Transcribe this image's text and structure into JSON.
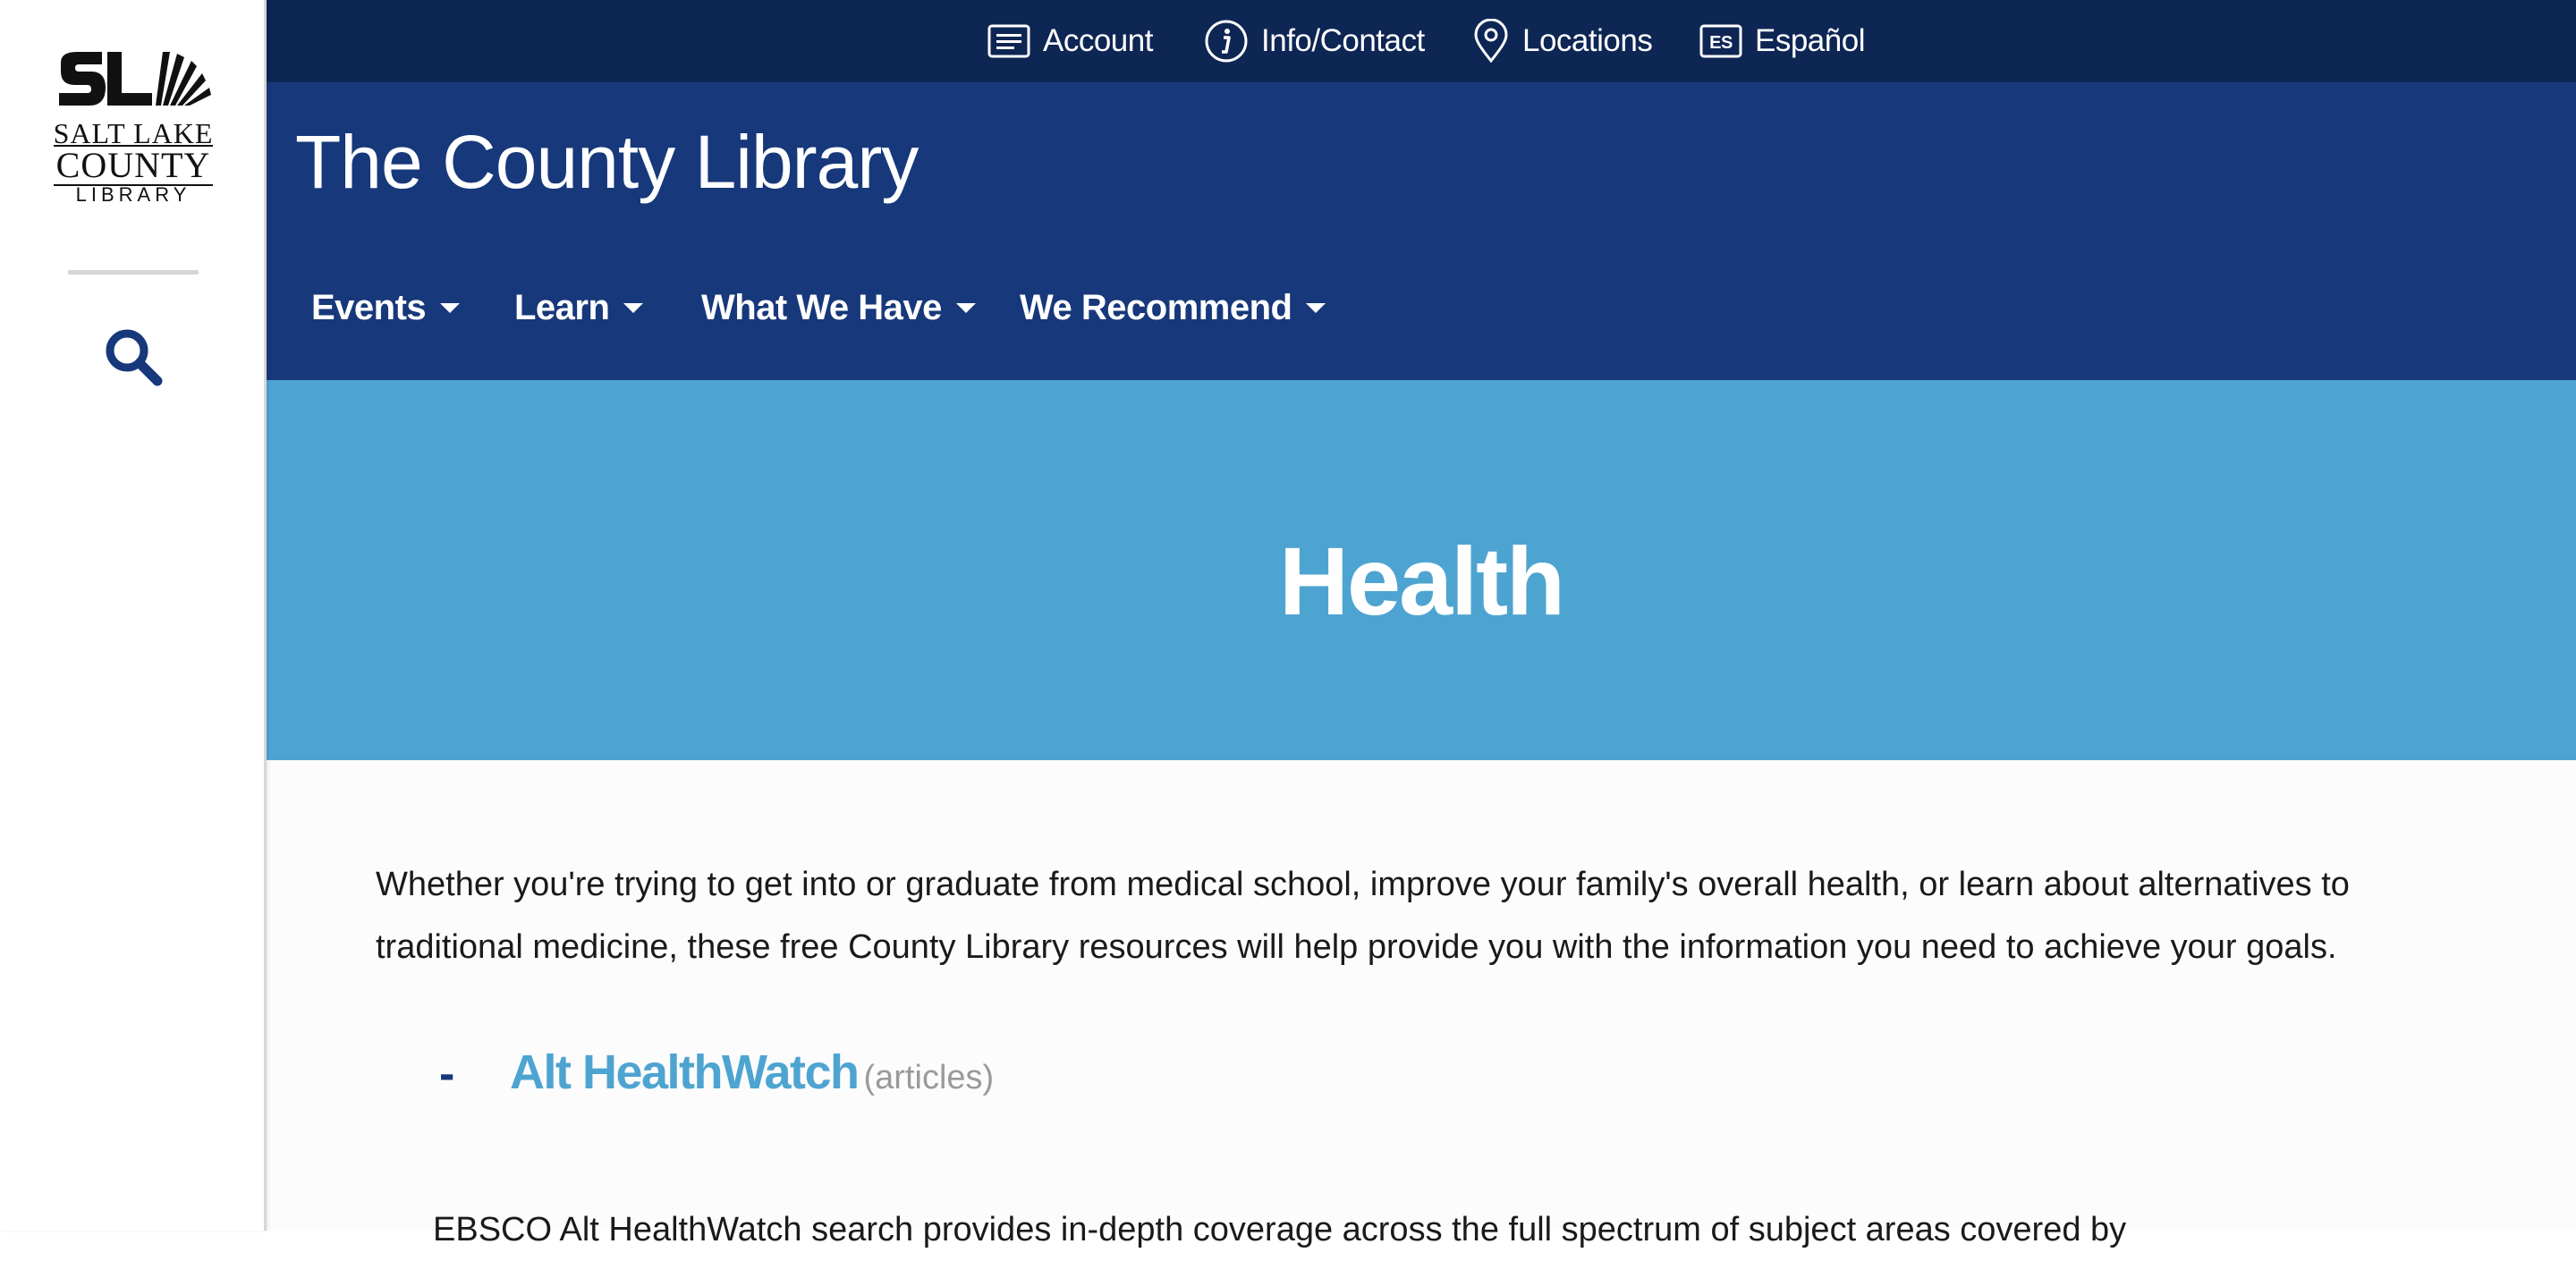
{
  "logo": {
    "line1": "SALT LAKE",
    "line2": "COUNTY",
    "line3": "LIBRARY"
  },
  "utility_nav": [
    {
      "label": "Account",
      "icon": "account-card-icon"
    },
    {
      "label": "Info/Contact",
      "icon": "info-icon"
    },
    {
      "label": "Locations",
      "icon": "location-pin-icon"
    },
    {
      "label": "Español",
      "icon": "es-language-icon",
      "icon_text": "ES"
    }
  ],
  "header": {
    "site_title": "The County Library"
  },
  "main_nav": [
    {
      "label": "Events"
    },
    {
      "label": "Learn"
    },
    {
      "label": "What We Have"
    },
    {
      "label": "We Recommend"
    }
  ],
  "hero": {
    "title": "Health"
  },
  "content": {
    "intro": "Whether you're trying to get into or graduate from medical school, improve your family's overall health, or learn about alternatives to traditional medicine, these free County Library resources will help provide you with the information you need to achieve your goals.",
    "resources": [
      {
        "bullet": "-",
        "title": "Alt HealthWatch",
        "type": "(articles)",
        "description": "EBSCO Alt HealthWatch search provides in-depth coverage across the full spectrum of subject areas covered by"
      }
    ]
  },
  "colors": {
    "utility_bar": "#0e2654",
    "header": "#17387a",
    "hero": "#4ea4d1",
    "link": "#4ea4d1",
    "search_icon": "#17387a"
  }
}
